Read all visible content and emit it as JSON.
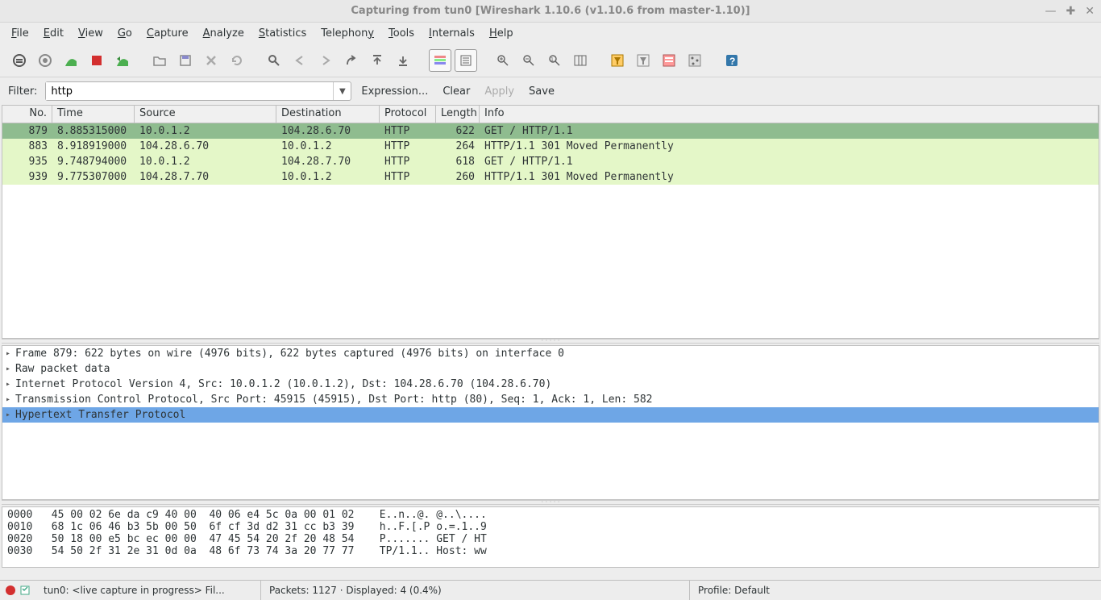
{
  "window": {
    "title": "Capturing from tun0    [Wireshark 1.10.6  (v1.10.6 from master-1.10)]"
  },
  "menu": {
    "items": [
      {
        "label": "File",
        "accel": 0
      },
      {
        "label": "Edit",
        "accel": 0
      },
      {
        "label": "View",
        "accel": 0
      },
      {
        "label": "Go",
        "accel": 0
      },
      {
        "label": "Capture",
        "accel": 0
      },
      {
        "label": "Analyze",
        "accel": 0
      },
      {
        "label": "Statistics",
        "accel": 0
      },
      {
        "label": "Telephony",
        "accel": 8
      },
      {
        "label": "Tools",
        "accel": 0
      },
      {
        "label": "Internals",
        "accel": 0
      },
      {
        "label": "Help",
        "accel": 0
      }
    ]
  },
  "filter": {
    "label": "Filter:",
    "value": "http",
    "expression": "Expression...",
    "clear": "Clear",
    "apply": "Apply",
    "save": "Save"
  },
  "columns": {
    "no": "No.",
    "time": "Time",
    "source": "Source",
    "destination": "Destination",
    "protocol": "Protocol",
    "length": "Length",
    "info": "Info"
  },
  "packets": [
    {
      "no": "879",
      "time": "8.885315000",
      "src": "10.0.1.2",
      "dst": "104.28.6.70",
      "proto": "HTTP",
      "len": "622",
      "info": "GET / HTTP/1.1",
      "sel": true
    },
    {
      "no": "883",
      "time": "8.918919000",
      "src": "104.28.6.70",
      "dst": "10.0.1.2",
      "proto": "HTTP",
      "len": "264",
      "info": "HTTP/1.1 301 Moved Permanently"
    },
    {
      "no": "935",
      "time": "9.748794000",
      "src": "10.0.1.2",
      "dst": "104.28.7.70",
      "proto": "HTTP",
      "len": "618",
      "info": "GET / HTTP/1.1"
    },
    {
      "no": "939",
      "time": "9.775307000",
      "src": "104.28.7.70",
      "dst": "10.0.1.2",
      "proto": "HTTP",
      "len": "260",
      "info": "HTTP/1.1 301 Moved Permanently"
    }
  ],
  "details": [
    {
      "text": "Frame 879: 622 bytes on wire (4976 bits), 622 bytes captured (4976 bits) on interface 0"
    },
    {
      "text": "Raw packet data"
    },
    {
      "text": "Internet Protocol Version 4, Src: 10.0.1.2 (10.0.1.2), Dst: 104.28.6.70 (104.28.6.70)"
    },
    {
      "text": "Transmission Control Protocol, Src Port: 45915 (45915), Dst Port: http (80), Seq: 1, Ack: 1, Len: 582"
    },
    {
      "text": "Hypertext Transfer Protocol",
      "sel": true
    }
  ],
  "bytes": [
    "0000   45 00 02 6e da c9 40 00  40 06 e4 5c 0a 00 01 02    E..n..@. @..\\....",
    "0010   68 1c 06 46 b3 5b 00 50  6f cf 3d d2 31 cc b3 39    h..F.[.P o.=.1..9",
    "0020   50 18 00 e5 bc ec 00 00  47 45 54 20 2f 20 48 54    P....... GET / HT",
    "0030   54 50 2f 31 2e 31 0d 0a  48 6f 73 74 3a 20 77 77    TP/1.1.. Host: ww"
  ],
  "status": {
    "left": "tun0: <live capture in progress> Fil...",
    "mid": "Packets: 1127 · Displayed: 4 (0.4%)",
    "right": "Profile: Default"
  }
}
